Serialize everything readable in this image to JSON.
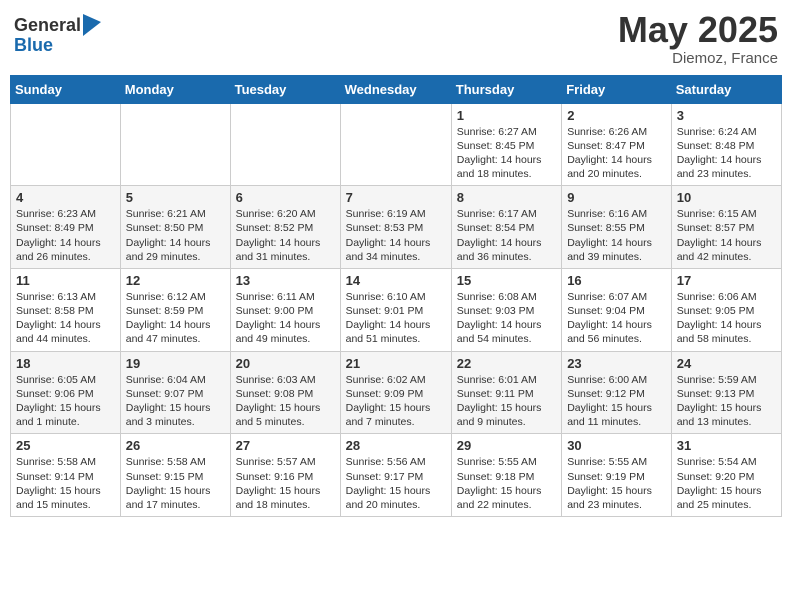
{
  "logo": {
    "general": "General",
    "blue": "Blue"
  },
  "title": {
    "month_year": "May 2025",
    "location": "Diemoz, France"
  },
  "days_of_week": [
    "Sunday",
    "Monday",
    "Tuesday",
    "Wednesday",
    "Thursday",
    "Friday",
    "Saturday"
  ],
  "weeks": [
    [
      {
        "day": "",
        "lines": []
      },
      {
        "day": "",
        "lines": []
      },
      {
        "day": "",
        "lines": []
      },
      {
        "day": "",
        "lines": []
      },
      {
        "day": "1",
        "lines": [
          "Sunrise: 6:27 AM",
          "Sunset: 8:45 PM",
          "Daylight: 14 hours",
          "and 18 minutes."
        ]
      },
      {
        "day": "2",
        "lines": [
          "Sunrise: 6:26 AM",
          "Sunset: 8:47 PM",
          "Daylight: 14 hours",
          "and 20 minutes."
        ]
      },
      {
        "day": "3",
        "lines": [
          "Sunrise: 6:24 AM",
          "Sunset: 8:48 PM",
          "Daylight: 14 hours",
          "and 23 minutes."
        ]
      }
    ],
    [
      {
        "day": "4",
        "lines": [
          "Sunrise: 6:23 AM",
          "Sunset: 8:49 PM",
          "Daylight: 14 hours",
          "and 26 minutes."
        ]
      },
      {
        "day": "5",
        "lines": [
          "Sunrise: 6:21 AM",
          "Sunset: 8:50 PM",
          "Daylight: 14 hours",
          "and 29 minutes."
        ]
      },
      {
        "day": "6",
        "lines": [
          "Sunrise: 6:20 AM",
          "Sunset: 8:52 PM",
          "Daylight: 14 hours",
          "and 31 minutes."
        ]
      },
      {
        "day": "7",
        "lines": [
          "Sunrise: 6:19 AM",
          "Sunset: 8:53 PM",
          "Daylight: 14 hours",
          "and 34 minutes."
        ]
      },
      {
        "day": "8",
        "lines": [
          "Sunrise: 6:17 AM",
          "Sunset: 8:54 PM",
          "Daylight: 14 hours",
          "and 36 minutes."
        ]
      },
      {
        "day": "9",
        "lines": [
          "Sunrise: 6:16 AM",
          "Sunset: 8:55 PM",
          "Daylight: 14 hours",
          "and 39 minutes."
        ]
      },
      {
        "day": "10",
        "lines": [
          "Sunrise: 6:15 AM",
          "Sunset: 8:57 PM",
          "Daylight: 14 hours",
          "and 42 minutes."
        ]
      }
    ],
    [
      {
        "day": "11",
        "lines": [
          "Sunrise: 6:13 AM",
          "Sunset: 8:58 PM",
          "Daylight: 14 hours",
          "and 44 minutes."
        ]
      },
      {
        "day": "12",
        "lines": [
          "Sunrise: 6:12 AM",
          "Sunset: 8:59 PM",
          "Daylight: 14 hours",
          "and 47 minutes."
        ]
      },
      {
        "day": "13",
        "lines": [
          "Sunrise: 6:11 AM",
          "Sunset: 9:00 PM",
          "Daylight: 14 hours",
          "and 49 minutes."
        ]
      },
      {
        "day": "14",
        "lines": [
          "Sunrise: 6:10 AM",
          "Sunset: 9:01 PM",
          "Daylight: 14 hours",
          "and 51 minutes."
        ]
      },
      {
        "day": "15",
        "lines": [
          "Sunrise: 6:08 AM",
          "Sunset: 9:03 PM",
          "Daylight: 14 hours",
          "and 54 minutes."
        ]
      },
      {
        "day": "16",
        "lines": [
          "Sunrise: 6:07 AM",
          "Sunset: 9:04 PM",
          "Daylight: 14 hours",
          "and 56 minutes."
        ]
      },
      {
        "day": "17",
        "lines": [
          "Sunrise: 6:06 AM",
          "Sunset: 9:05 PM",
          "Daylight: 14 hours",
          "and 58 minutes."
        ]
      }
    ],
    [
      {
        "day": "18",
        "lines": [
          "Sunrise: 6:05 AM",
          "Sunset: 9:06 PM",
          "Daylight: 15 hours",
          "and 1 minute."
        ]
      },
      {
        "day": "19",
        "lines": [
          "Sunrise: 6:04 AM",
          "Sunset: 9:07 PM",
          "Daylight: 15 hours",
          "and 3 minutes."
        ]
      },
      {
        "day": "20",
        "lines": [
          "Sunrise: 6:03 AM",
          "Sunset: 9:08 PM",
          "Daylight: 15 hours",
          "and 5 minutes."
        ]
      },
      {
        "day": "21",
        "lines": [
          "Sunrise: 6:02 AM",
          "Sunset: 9:09 PM",
          "Daylight: 15 hours",
          "and 7 minutes."
        ]
      },
      {
        "day": "22",
        "lines": [
          "Sunrise: 6:01 AM",
          "Sunset: 9:11 PM",
          "Daylight: 15 hours",
          "and 9 minutes."
        ]
      },
      {
        "day": "23",
        "lines": [
          "Sunrise: 6:00 AM",
          "Sunset: 9:12 PM",
          "Daylight: 15 hours",
          "and 11 minutes."
        ]
      },
      {
        "day": "24",
        "lines": [
          "Sunrise: 5:59 AM",
          "Sunset: 9:13 PM",
          "Daylight: 15 hours",
          "and 13 minutes."
        ]
      }
    ],
    [
      {
        "day": "25",
        "lines": [
          "Sunrise: 5:58 AM",
          "Sunset: 9:14 PM",
          "Daylight: 15 hours",
          "and 15 minutes."
        ]
      },
      {
        "day": "26",
        "lines": [
          "Sunrise: 5:58 AM",
          "Sunset: 9:15 PM",
          "Daylight: 15 hours",
          "and 17 minutes."
        ]
      },
      {
        "day": "27",
        "lines": [
          "Sunrise: 5:57 AM",
          "Sunset: 9:16 PM",
          "Daylight: 15 hours",
          "and 18 minutes."
        ]
      },
      {
        "day": "28",
        "lines": [
          "Sunrise: 5:56 AM",
          "Sunset: 9:17 PM",
          "Daylight: 15 hours",
          "and 20 minutes."
        ]
      },
      {
        "day": "29",
        "lines": [
          "Sunrise: 5:55 AM",
          "Sunset: 9:18 PM",
          "Daylight: 15 hours",
          "and 22 minutes."
        ]
      },
      {
        "day": "30",
        "lines": [
          "Sunrise: 5:55 AM",
          "Sunset: 9:19 PM",
          "Daylight: 15 hours",
          "and 23 minutes."
        ]
      },
      {
        "day": "31",
        "lines": [
          "Sunrise: 5:54 AM",
          "Sunset: 9:20 PM",
          "Daylight: 15 hours",
          "and 25 minutes."
        ]
      }
    ]
  ]
}
